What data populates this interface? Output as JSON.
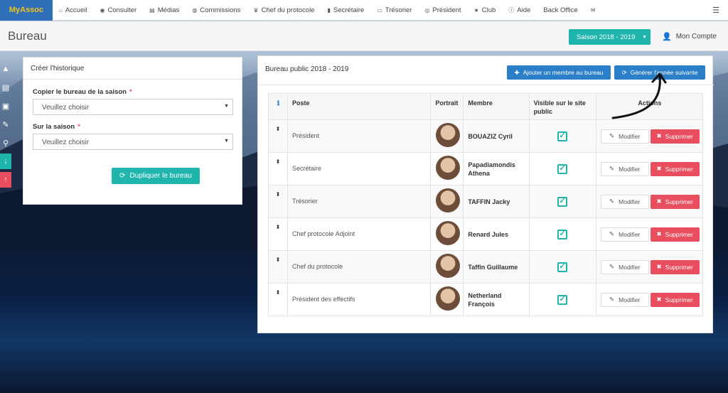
{
  "brand": "MyAssoc",
  "nav": [
    {
      "icon": "home-icon",
      "glyph": "⌂",
      "label": "Accueil"
    },
    {
      "icon": "eye-icon",
      "glyph": "◉",
      "label": "Consulter"
    },
    {
      "icon": "file-icon",
      "glyph": "▤",
      "label": "Médias"
    },
    {
      "icon": "user-circle-icon",
      "glyph": "◍",
      "label": "Commissions"
    },
    {
      "icon": "trophy-icon",
      "glyph": "♛",
      "label": "Chef du protocole"
    },
    {
      "icon": "book-icon",
      "glyph": "▮",
      "label": "Secrétaire"
    },
    {
      "icon": "money-icon",
      "glyph": "▭",
      "label": "Trésorier"
    },
    {
      "icon": "globe-icon",
      "glyph": "◎",
      "label": "Président"
    },
    {
      "icon": "star-icon",
      "glyph": "★",
      "label": "Club"
    },
    {
      "icon": "info-icon",
      "glyph": "ⓘ",
      "label": "Aide"
    },
    {
      "icon": "",
      "glyph": "",
      "label": "Back Office"
    },
    {
      "icon": "envelope-icon",
      "glyph": "✉",
      "label": ""
    }
  ],
  "nav_menu_icon": "☰",
  "page_title": "Bureau",
  "season_label": "Saison 2018 - 2019",
  "account_label": "Mon Compte",
  "left_panel": {
    "title": "Créer l'historique",
    "label_copy": "Copier le bureau de la saison",
    "label_season": "Sur la saison",
    "required_mark": "*",
    "select_placeholder": "Veuillez choisir",
    "duplicate_button": "Dupliquer le bureau"
  },
  "right_panel": {
    "title": "Bureau public 2018 - 2019",
    "add_member_button": "Ajouter un membre au bureau",
    "generate_button": "Générer l'année suivante",
    "headers": {
      "info": "ℹ",
      "poste": "Poste",
      "portrait": "Portrait",
      "membre": "Membre",
      "visible": "Visible sur le site public",
      "actions": "Actions"
    },
    "modify_label": "Modifier",
    "delete_label": "Supprimer",
    "rows": [
      {
        "poste": "Président",
        "membre": "BOUAZIZ Cyril"
      },
      {
        "poste": "Secrétaire",
        "membre": "Papadiamondis Athena"
      },
      {
        "poste": "Trésorier",
        "membre": "TAFFIN Jacky"
      },
      {
        "poste": "Chef protocole Adjoint",
        "membre": "Renard Jules"
      },
      {
        "poste": "Chef du protocole",
        "membre": "Taffin Guillaume"
      },
      {
        "poste": "Président des effectifs",
        "membre": "Netherland François"
      }
    ]
  },
  "colors": {
    "teal": "#1fb5ad",
    "blue": "#2a7fc8",
    "red": "#e94e5e",
    "brand_bg": "#2f6fb8",
    "brand_text": "#f3c21b"
  }
}
